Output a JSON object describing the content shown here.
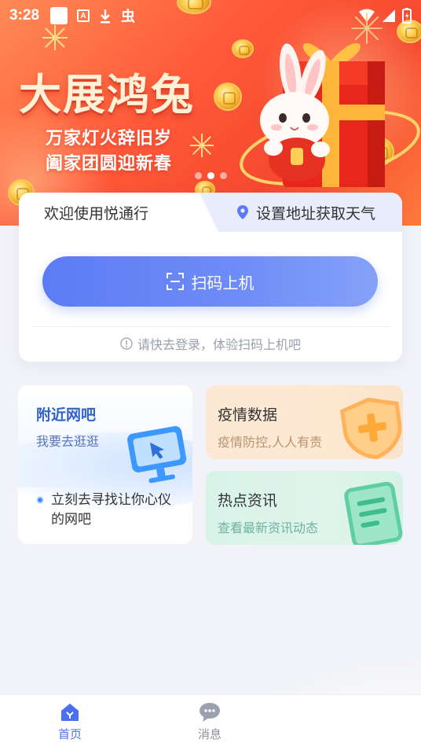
{
  "status_bar": {
    "time": "3:28",
    "glyph_a": "A",
    "glyph_bug": "虫"
  },
  "banner": {
    "title": "大展鸿兔",
    "line1": "万家灯火辞旧岁",
    "line2": "阖家团圆迎新春",
    "slides": 3,
    "active_slide": 2
  },
  "welcome": {
    "greeting": "欢迎使用悦通行",
    "location_label": "设置地址获取天气",
    "scan_button": "扫码上机",
    "login_hint": "请快去登录，体验扫码上机吧"
  },
  "nearby": {
    "title": "附近网吧",
    "subtitle": "我要去逛逛",
    "description": "立刻去寻找让你心仪的网吧"
  },
  "features": [
    {
      "title": "疫情数据",
      "subtitle": "疫情防控,人人有责",
      "icon": "shield-plus-icon"
    },
    {
      "title": "热点资讯",
      "subtitle": "查看最新资讯动态",
      "icon": "document-icon"
    }
  ],
  "bottom_nav": [
    {
      "label": "首页",
      "icon": "home-icon",
      "active": true
    },
    {
      "label": "消息",
      "icon": "chat-icon",
      "active": false
    }
  ],
  "colors": {
    "primary": "#5b7cf4",
    "banner_red": "#f5492f",
    "epidemic_bg": "#fbe9d5",
    "news_bg": "#d9f3e9",
    "page_bg": "#f2f3f8"
  }
}
